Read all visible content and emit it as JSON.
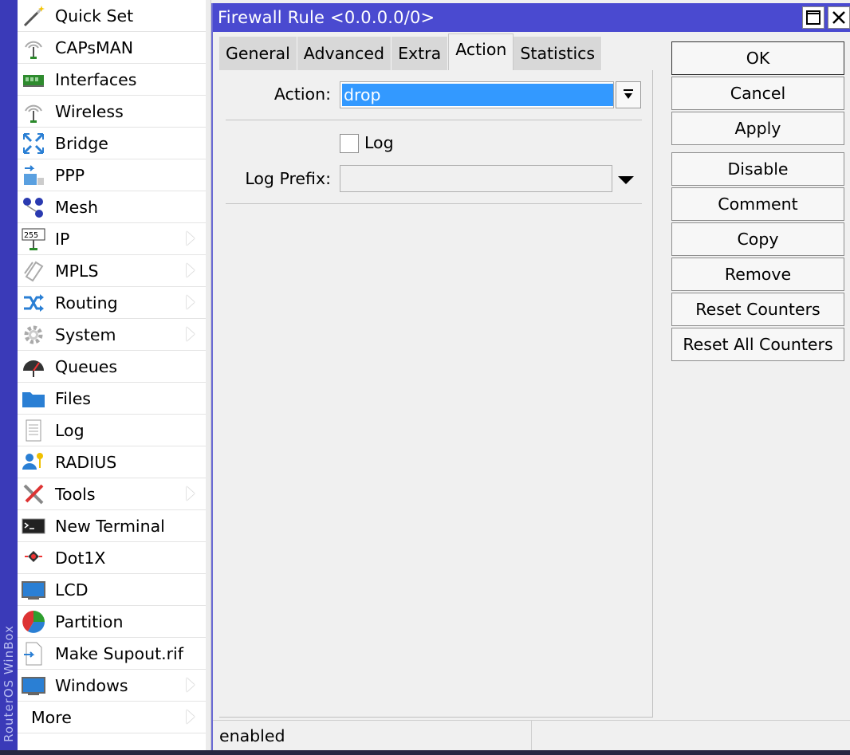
{
  "brand": "RouterOS WinBox",
  "sidebar": {
    "items": [
      {
        "label": "Quick Set",
        "icon": "magic-wand-icon",
        "submenu": false
      },
      {
        "label": "CAPsMAN",
        "icon": "wireless-antenna-icon",
        "submenu": false
      },
      {
        "label": "Interfaces",
        "icon": "network-card-icon",
        "submenu": false
      },
      {
        "label": "Wireless",
        "icon": "wireless-antenna-icon",
        "submenu": false
      },
      {
        "label": "Bridge",
        "icon": "bridge-icon",
        "submenu": false
      },
      {
        "label": "PPP",
        "icon": "ppp-icon",
        "submenu": false
      },
      {
        "label": "Mesh",
        "icon": "mesh-icon",
        "submenu": false
      },
      {
        "label": "IP",
        "icon": "ip-icon",
        "submenu": true
      },
      {
        "label": "MPLS",
        "icon": "mpls-tag-icon",
        "submenu": true
      },
      {
        "label": "Routing",
        "icon": "routing-icon",
        "submenu": true
      },
      {
        "label": "System",
        "icon": "gear-icon",
        "submenu": true
      },
      {
        "label": "Queues",
        "icon": "queues-gauge-icon",
        "submenu": false
      },
      {
        "label": "Files",
        "icon": "folder-icon",
        "submenu": false
      },
      {
        "label": "Log",
        "icon": "log-document-icon",
        "submenu": false
      },
      {
        "label": "RADIUS",
        "icon": "radius-user-key-icon",
        "submenu": false
      },
      {
        "label": "Tools",
        "icon": "tools-icon",
        "submenu": true
      },
      {
        "label": "New Terminal",
        "icon": "terminal-icon",
        "submenu": false
      },
      {
        "label": "Dot1X",
        "icon": "dot1x-icon",
        "submenu": false
      },
      {
        "label": "LCD",
        "icon": "monitor-icon",
        "submenu": false
      },
      {
        "label": "Partition",
        "icon": "pie-chart-icon",
        "submenu": false
      },
      {
        "label": "Make Supout.rif",
        "icon": "supout-file-icon",
        "submenu": false
      },
      {
        "label": "Windows",
        "icon": "monitor-icon",
        "submenu": true
      },
      {
        "label": "More",
        "icon": "",
        "submenu": true
      }
    ]
  },
  "window": {
    "title": "Firewall Rule <0.0.0.0/0>",
    "tabs": [
      {
        "label": "General",
        "active": false
      },
      {
        "label": "Advanced",
        "active": false
      },
      {
        "label": "Extra",
        "active": false
      },
      {
        "label": "Action",
        "active": true
      },
      {
        "label": "Statistics",
        "active": false
      }
    ],
    "form": {
      "action_label": "Action:",
      "action_value": "drop",
      "log_label": "Log",
      "log_checked": false,
      "log_prefix_label": "Log Prefix:",
      "log_prefix_value": ""
    },
    "buttons": {
      "ok": "OK",
      "cancel": "Cancel",
      "apply": "Apply",
      "disable": "Disable",
      "comment": "Comment",
      "copy": "Copy",
      "remove": "Remove",
      "reset_counters": "Reset Counters",
      "reset_all_counters": "Reset All Counters"
    },
    "status": "enabled"
  },
  "colors": {
    "titlebar": "#4a4ad0",
    "brandbar": "#3a3ab8",
    "selection": "#3399ff"
  }
}
